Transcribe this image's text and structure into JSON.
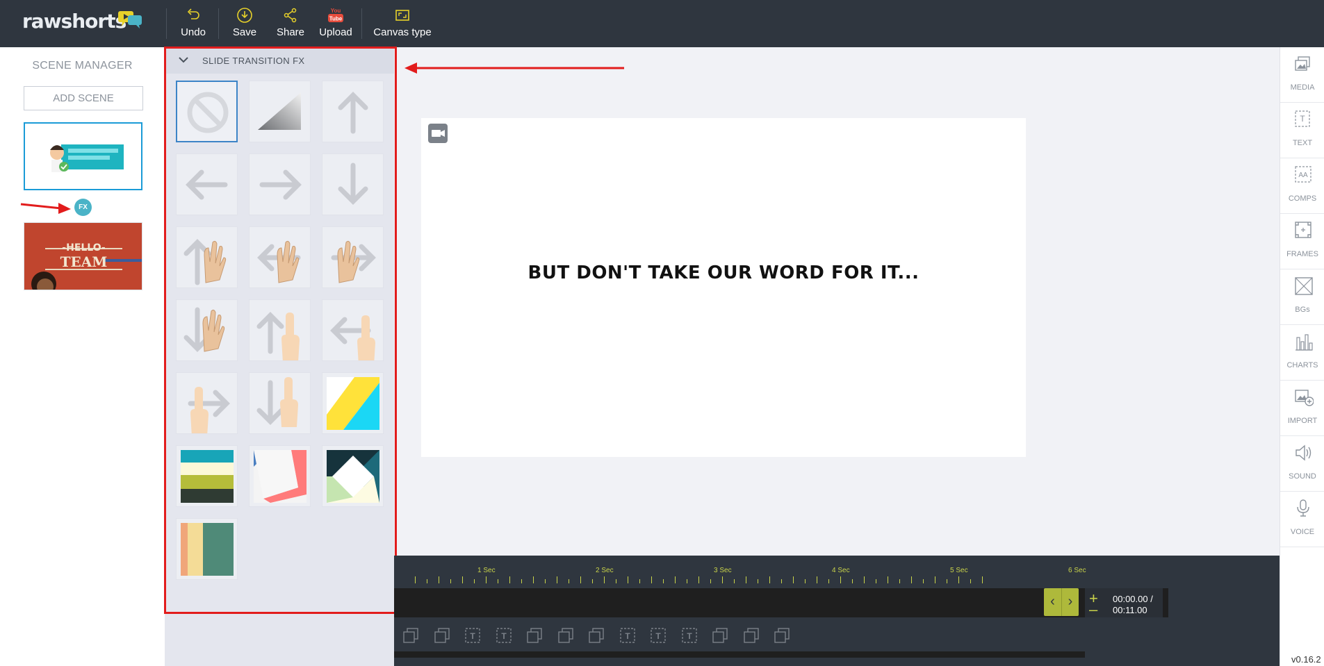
{
  "app": {
    "logo_raw": "raw",
    "logo_shorts": "shorts",
    "version": "v0.16.2"
  },
  "toolbar": {
    "undo_label": "Undo",
    "save_label": "Save",
    "share_label": "Share",
    "upload_label": "Upload",
    "upload_badge": "You Tube",
    "canvas_type_label": "Canvas type"
  },
  "scene_manager": {
    "title": "SCENE MANAGER",
    "add_scene_label": "ADD SCENE",
    "fx_badge": "FX",
    "scene2_text_line1": "-HELLO-",
    "scene2_text_line2": "TEAM"
  },
  "fx_panel": {
    "title": "SLIDE TRANSITION FX",
    "tiles": [
      "none-icon",
      "fade-icon",
      "arrow-up-icon",
      "arrow-left-icon",
      "arrow-right-icon",
      "arrow-down-icon",
      "hand-swipe-up-icon",
      "hand-swipe-left-icon",
      "hand-swipe-right-icon",
      "hand-swipe-down-icon",
      "finger-swipe-up-icon",
      "finger-swipe-left-icon",
      "finger-swipe-right-icon",
      "finger-swipe-down-icon",
      "diagonal-wipe-icon",
      "stripes-wipe-icon",
      "paper-fold-icon",
      "diamond-wipe-icon",
      "vertical-bars-icon"
    ]
  },
  "canvas": {
    "text": "BUT DON'T TAKE OUR WORD FOR IT..."
  },
  "timeline": {
    "ruler": [
      "1 Sec",
      "2 Sec",
      "3 Sec",
      "4 Sec",
      "5 Sec",
      "6 Sec"
    ],
    "current_time": "00:00.00 /",
    "total_time": "00:11.00"
  },
  "right_tools": [
    {
      "label": "MEDIA",
      "icon": "media-icon"
    },
    {
      "label": "TEXT",
      "icon": "text-icon"
    },
    {
      "label": "COMPS",
      "icon": "comps-icon"
    },
    {
      "label": "FRAMES",
      "icon": "frames-icon"
    },
    {
      "label": "BGs",
      "icon": "backgrounds-icon"
    },
    {
      "label": "CHARTS",
      "icon": "charts-icon"
    },
    {
      "label": "IMPORT",
      "icon": "import-icon"
    },
    {
      "label": "SOUND",
      "icon": "sound-icon"
    },
    {
      "label": "VOICE",
      "icon": "voice-icon"
    }
  ],
  "colors": {
    "topbar": "#2f363f",
    "accent_yellow": "#e7d12a",
    "selection_blue": "#1a9bd7",
    "annotation_red": "#e21c1c",
    "timeline_green": "#aeb93b"
  }
}
